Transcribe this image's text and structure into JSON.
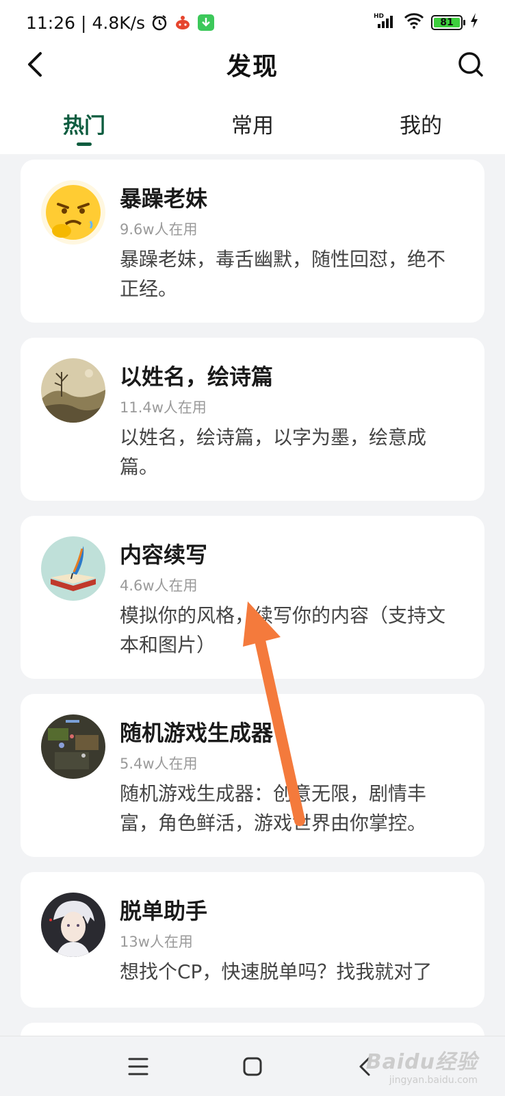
{
  "status_bar": {
    "time": "11:26",
    "network_speed": "4.8K/s",
    "battery": "81",
    "icons": [
      "alarm-icon",
      "app-notification-icon",
      "download-icon",
      "hd-signal-icon",
      "wifi-icon",
      "battery-icon",
      "charging-icon"
    ]
  },
  "header": {
    "title": "发现",
    "back_icon": "back-arrow-icon",
    "search_icon": "search-icon"
  },
  "tabs": [
    {
      "label": "热门",
      "active": true
    },
    {
      "label": "常用",
      "active": false
    },
    {
      "label": "我的",
      "active": false
    }
  ],
  "cards": [
    {
      "title": "暴躁老妹",
      "users": "9.6w人在用",
      "desc": "暴躁老妹，毒舌幽默，随性回怼，绝不正经。",
      "avatar": "angry-emoji-avatar"
    },
    {
      "title": "以姓名，绘诗篇",
      "users": "11.4w人在用",
      "desc": "以姓名，绘诗篇，以字为墨，绘意成篇。",
      "avatar": "landscape-painting-avatar"
    },
    {
      "title": "内容续写",
      "users": "4.6w人在用",
      "desc": "模拟你的风格，续写你的内容（支持文本和图片）",
      "avatar": "quill-book-avatar"
    },
    {
      "title": "随机游戏生成器",
      "users": "5.4w人在用",
      "desc": "随机游戏生成器：创意无限，剧情丰富，角色鲜活，游戏世界由你掌控。",
      "avatar": "game-scene-avatar"
    },
    {
      "title": "脱单助手",
      "users": "13w人在用",
      "desc": "想找个CP，快速脱单吗？找我就对了",
      "avatar": "anime-character-avatar"
    }
  ],
  "colors": {
    "accent": "#0d5c3f",
    "annotation_arrow": "#f47a3c",
    "background": "#f2f3f5"
  },
  "watermark": {
    "text": "Baidu经验",
    "sub": "jingyan.baidu.com"
  }
}
